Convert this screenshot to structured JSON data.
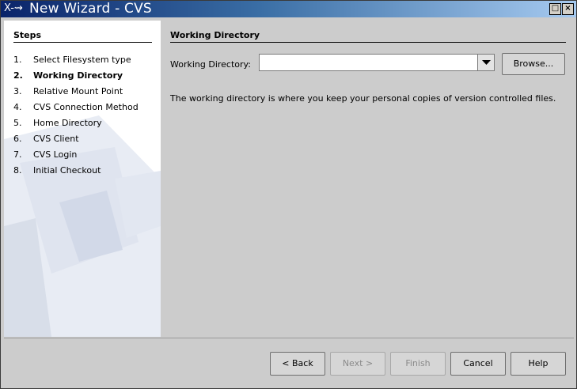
{
  "window": {
    "title": "New Wizard - CVS",
    "wm_icon": "X-⇝"
  },
  "steps": {
    "heading": "Steps",
    "items": [
      {
        "num": "1.",
        "label": "Select Filesystem type",
        "current": false
      },
      {
        "num": "2.",
        "label": "Working Directory",
        "current": true
      },
      {
        "num": "3.",
        "label": "Relative Mount Point",
        "current": false
      },
      {
        "num": "4.",
        "label": "CVS Connection Method",
        "current": false
      },
      {
        "num": "5.",
        "label": "Home Directory",
        "current": false
      },
      {
        "num": "6.",
        "label": "CVS Client",
        "current": false
      },
      {
        "num": "7.",
        "label": "CVS Login",
        "current": false
      },
      {
        "num": "8.",
        "label": "Initial Checkout",
        "current": false
      }
    ]
  },
  "content": {
    "section_title": "Working Directory",
    "field_label": "Working Directory:",
    "field_value": "",
    "browse_label": "Browse...",
    "description": "The working directory is where you keep your personal copies of version controlled files."
  },
  "buttons": {
    "back": "< Back",
    "next": "Next >",
    "finish": "Finish",
    "cancel": "Cancel",
    "help": "Help"
  }
}
